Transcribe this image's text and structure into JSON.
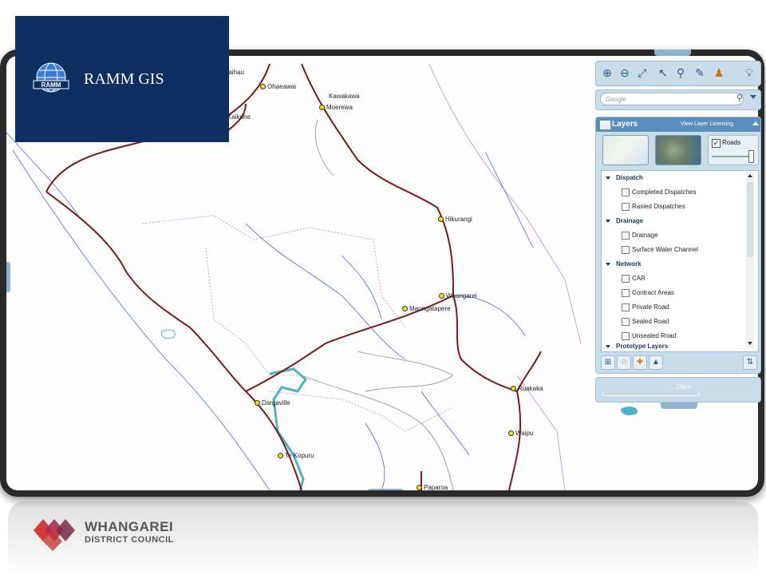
{
  "header": {
    "app_title": "RAMM GIS",
    "logo_icon": "ramm-globe-icon"
  },
  "footer": {
    "org_name": "WHANGAREI",
    "org_sub": "DISTRICT COUNCIL",
    "logo_icon": "wdc-chevron-logo"
  },
  "map": {
    "towns": [
      {
        "name": "Kaihau"
      },
      {
        "name": "Ohaeawai"
      },
      {
        "name": "Kawakawa"
      },
      {
        "name": "Moerewa"
      },
      {
        "name": "Kaikohe"
      },
      {
        "name": "Hikurangi"
      },
      {
        "name": "Whangarei"
      },
      {
        "name": "Maungatapere"
      },
      {
        "name": "Ruakaka"
      },
      {
        "name": "Dargaville"
      },
      {
        "name": "Waipu"
      },
      {
        "name": "Te Kopuru"
      },
      {
        "name": "Paparoa"
      }
    ],
    "colors": {
      "road": "#7a1a1a",
      "boundary": "#c88ad8",
      "river": "#3a4fd8",
      "water": "#4fb3c8"
    }
  },
  "search": {
    "placeholder": "Google"
  },
  "layers": {
    "title": "Layers",
    "licensing_link": "View Layer Licensing",
    "roads_label": "Roads",
    "roads_checked": true,
    "groups": [
      {
        "name": "Dispatch",
        "items": [
          "Completed Dispatches",
          "Rasied Dispatches"
        ]
      },
      {
        "name": "Drainage",
        "items": [
          "Drainage",
          "Surface Water Channel"
        ]
      },
      {
        "name": "Network",
        "items": [
          "CAR",
          "Contract Areas",
          "Private Road",
          "Sealed Road",
          "Unsealed Road"
        ]
      },
      {
        "name": "Prototype Layers",
        "items": []
      }
    ]
  },
  "scale": {
    "label": "15km"
  }
}
